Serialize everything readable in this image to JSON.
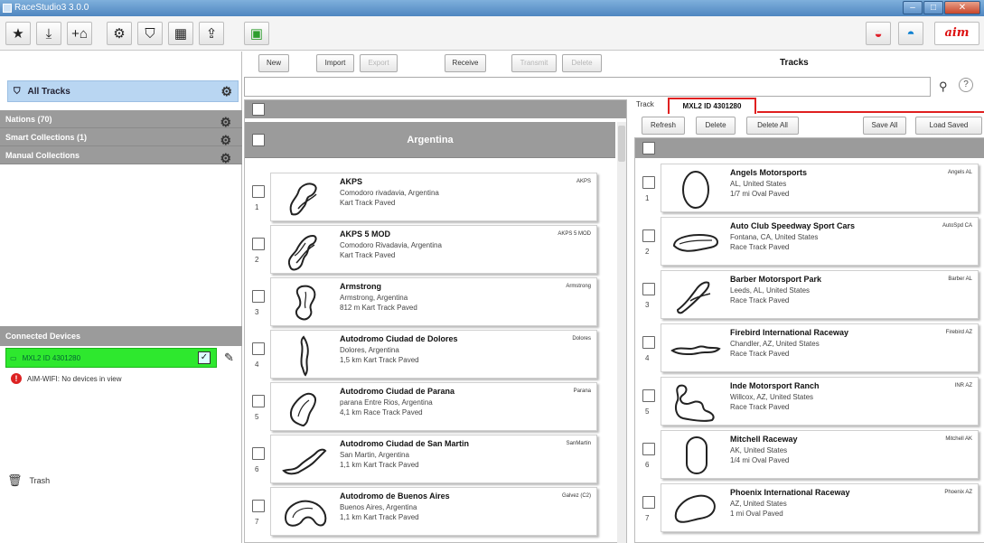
{
  "window": {
    "title": "RaceStudio3 3.0.0"
  },
  "toolbar": {
    "icons": [
      "star-icon",
      "download-icon",
      "add-track-icon",
      "settings-icon",
      "tracks-icon",
      "layout-icon",
      "upload-icon",
      "device-icon"
    ],
    "right_icons": [
      "wifi-icon",
      "helmet-icon"
    ],
    "logo": "aim"
  },
  "sidebar": {
    "all_tracks": "All Tracks",
    "collections": [
      {
        "label": "Nations  (70)"
      },
      {
        "label": "Smart Collections  (1)"
      },
      {
        "label": "Manual Collections"
      }
    ],
    "devices_header": "Connected Devices",
    "device": "MXL2 ID 4301280",
    "wifi_status": "AIM-WIFI: No devices in view",
    "trash": "Trash"
  },
  "actions": {
    "new": "New",
    "import": "Import",
    "export": "Export",
    "receive": "Receive",
    "transmit": "Transmit",
    "delete": "Delete"
  },
  "tracks_title": "Tracks",
  "left_list": {
    "country": "Argentina",
    "items": [
      {
        "num": "1",
        "name": "AKPS",
        "loc": "Comodoro rivadavia, Argentina",
        "type": "Kart Track Paved",
        "code": "AKPS"
      },
      {
        "num": "2",
        "name": "AKPS 5 MOD",
        "loc": "Comodoro Rivadavia, Argentina",
        "type": "Kart Track Paved",
        "code": "AKPS 5 MOD"
      },
      {
        "num": "3",
        "name": "Armstrong",
        "loc": "Armstrong, Argentina",
        "type": "812 m Kart Track Paved",
        "code": "Armstrong"
      },
      {
        "num": "4",
        "name": "Autodromo Ciudad de Dolores",
        "loc": "Dolores, Argentina",
        "type": "1,5 km Kart Track Paved",
        "code": "Dolores"
      },
      {
        "num": "5",
        "name": "Autodromo Ciudad de Parana",
        "loc": "parana Entre Rios, Argentina",
        "type": "4,1 km Race Track Paved",
        "code": "Parana"
      },
      {
        "num": "6",
        "name": "Autodromo Ciudad de San Martin",
        "loc": "San Martin, Argentina",
        "type": "1,1 km Kart Track Paved",
        "code": "SanMartin"
      },
      {
        "num": "7",
        "name": "Autodromo de Buenos Aires",
        "loc": "Buenos Aires, Argentina",
        "type": "1,1 km Kart Track Paved",
        "code": "Galvez (C2)"
      }
    ]
  },
  "right_panel": {
    "tab_label": "Track",
    "device_tab": "MXL2 ID 4301280",
    "buttons": {
      "refresh": "Refresh",
      "delete": "Delete",
      "delete_all": "Delete All",
      "save_all": "Save All",
      "load_saved": "Load Saved"
    },
    "items": [
      {
        "num": "1",
        "name": "Angels Motorsports",
        "loc": "AL, United States",
        "type": "1/7 mi Oval Paved",
        "code": "Angels AL"
      },
      {
        "num": "2",
        "name": "Auto Club Speedway Sport Cars",
        "loc": "Fontana, CA, United States",
        "type": "Race Track Paved",
        "code": "AutoSpd CA"
      },
      {
        "num": "3",
        "name": "Barber Motorsport Park",
        "loc": "Leeds, AL, United States",
        "type": "Race Track Paved",
        "code": "Barber AL"
      },
      {
        "num": "4",
        "name": "Firebird International Raceway",
        "loc": "Chandler, AZ, United States",
        "type": "Race Track Paved",
        "code": "Firebird AZ"
      },
      {
        "num": "5",
        "name": "Inde Motorsport Ranch",
        "loc": "Willcox, AZ, United States",
        "type": "Race Track Paved",
        "code": "INR AZ"
      },
      {
        "num": "6",
        "name": "Mitchell Raceway",
        "loc": "AK, United States",
        "type": "1/4 mi Oval Paved",
        "code": "Mitchell AK"
      },
      {
        "num": "7",
        "name": "Phoenix International Raceway",
        "loc": "AZ, United States",
        "type": "1 mi Oval Paved",
        "code": "Phoenix AZ"
      }
    ]
  }
}
